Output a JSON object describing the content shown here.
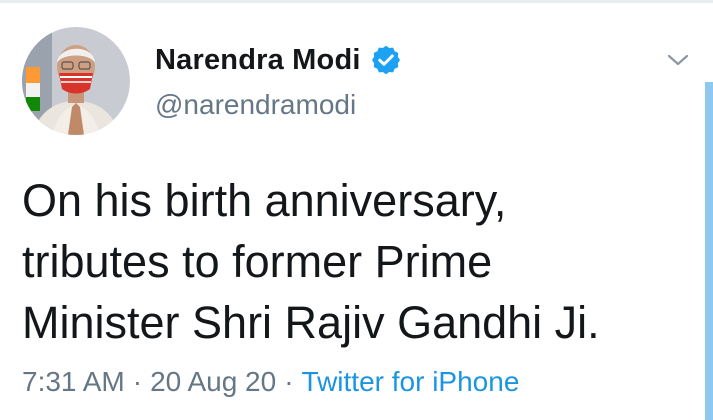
{
  "tweet": {
    "author": {
      "display_name": "Narendra Modi",
      "handle": "@narendramodi",
      "verified": true,
      "avatar_icon": "profile-photo"
    },
    "text_lines": [
      "On his birth anniversary,",
      "tributes to former Prime",
      "Minister Shri Rajiv Gandhi Ji."
    ],
    "time": "7:31 AM",
    "date": "20 Aug 20",
    "separator": "·",
    "source": "Twitter for iPhone",
    "menu_icon": "chevron-down-icon"
  },
  "colors": {
    "text_primary": "#14171a",
    "text_secondary": "#657786",
    "link": "#1b95e0",
    "verified_badge": "#1da1f2"
  }
}
